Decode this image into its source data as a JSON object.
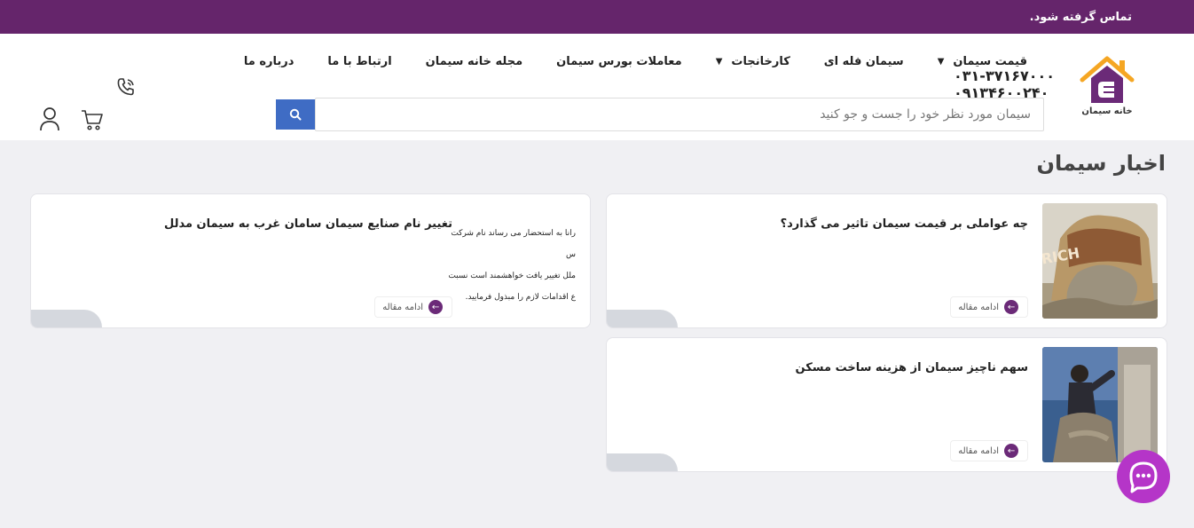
{
  "topbar": {
    "text": "تماس گرفته شود."
  },
  "logo": {
    "text": "خانه سیمان",
    "color": "#6b2a78",
    "roof_color": "#f5a623"
  },
  "nav": {
    "items": [
      {
        "label": "قیمت سیمان",
        "has_dropdown": true
      },
      {
        "label": "سیمان فله ای",
        "has_dropdown": false
      },
      {
        "label": "کارخانجات",
        "has_dropdown": true
      },
      {
        "label": "معاملات بورس سیمان",
        "has_dropdown": false
      },
      {
        "label": "مجله خانه سیمان",
        "has_dropdown": false
      },
      {
        "label": "ارتباط با ما",
        "has_dropdown": false
      },
      {
        "label": "درباره ما",
        "has_dropdown": false
      }
    ]
  },
  "search": {
    "placeholder": "سیمان مورد نظر خود را جست و جو کنید",
    "value": ""
  },
  "contact": {
    "phone1": "۰۳۱-۳۷۱۶۷۰۰۰",
    "phone2": "۰۹۱۳۴۶۰۰۲۴۰"
  },
  "section": {
    "title": "اخبار سیمان"
  },
  "articles": [
    {
      "title": "چه عواملی بر قیمت سیمان تاثیر می گذارد؟",
      "more_label": "ادامه مقاله",
      "image": "cement-bags"
    },
    {
      "title": "سهم ناچیز سیمان از هزینه ساخت مسکن",
      "more_label": "ادامه مقاله",
      "image": "construction-worker"
    },
    {
      "title": "تغییر نام صنایع سیمان سامان غرب به سیمان مدلل",
      "more_label": "ادامه مقاله",
      "image": "document",
      "doc_lines": [
        "رانا به استحضار می رساند نام شرکت صنایع س",
        "ملل تغییر یافت خواهشمند است نسبت به",
        "ع اقدامات لازم را مبذول فرمایید."
      ]
    }
  ],
  "colors": {
    "topbar": "#65256b",
    "search_button": "#3f6cc4",
    "accent": "#6b2a78",
    "chat": "#b535c8"
  }
}
